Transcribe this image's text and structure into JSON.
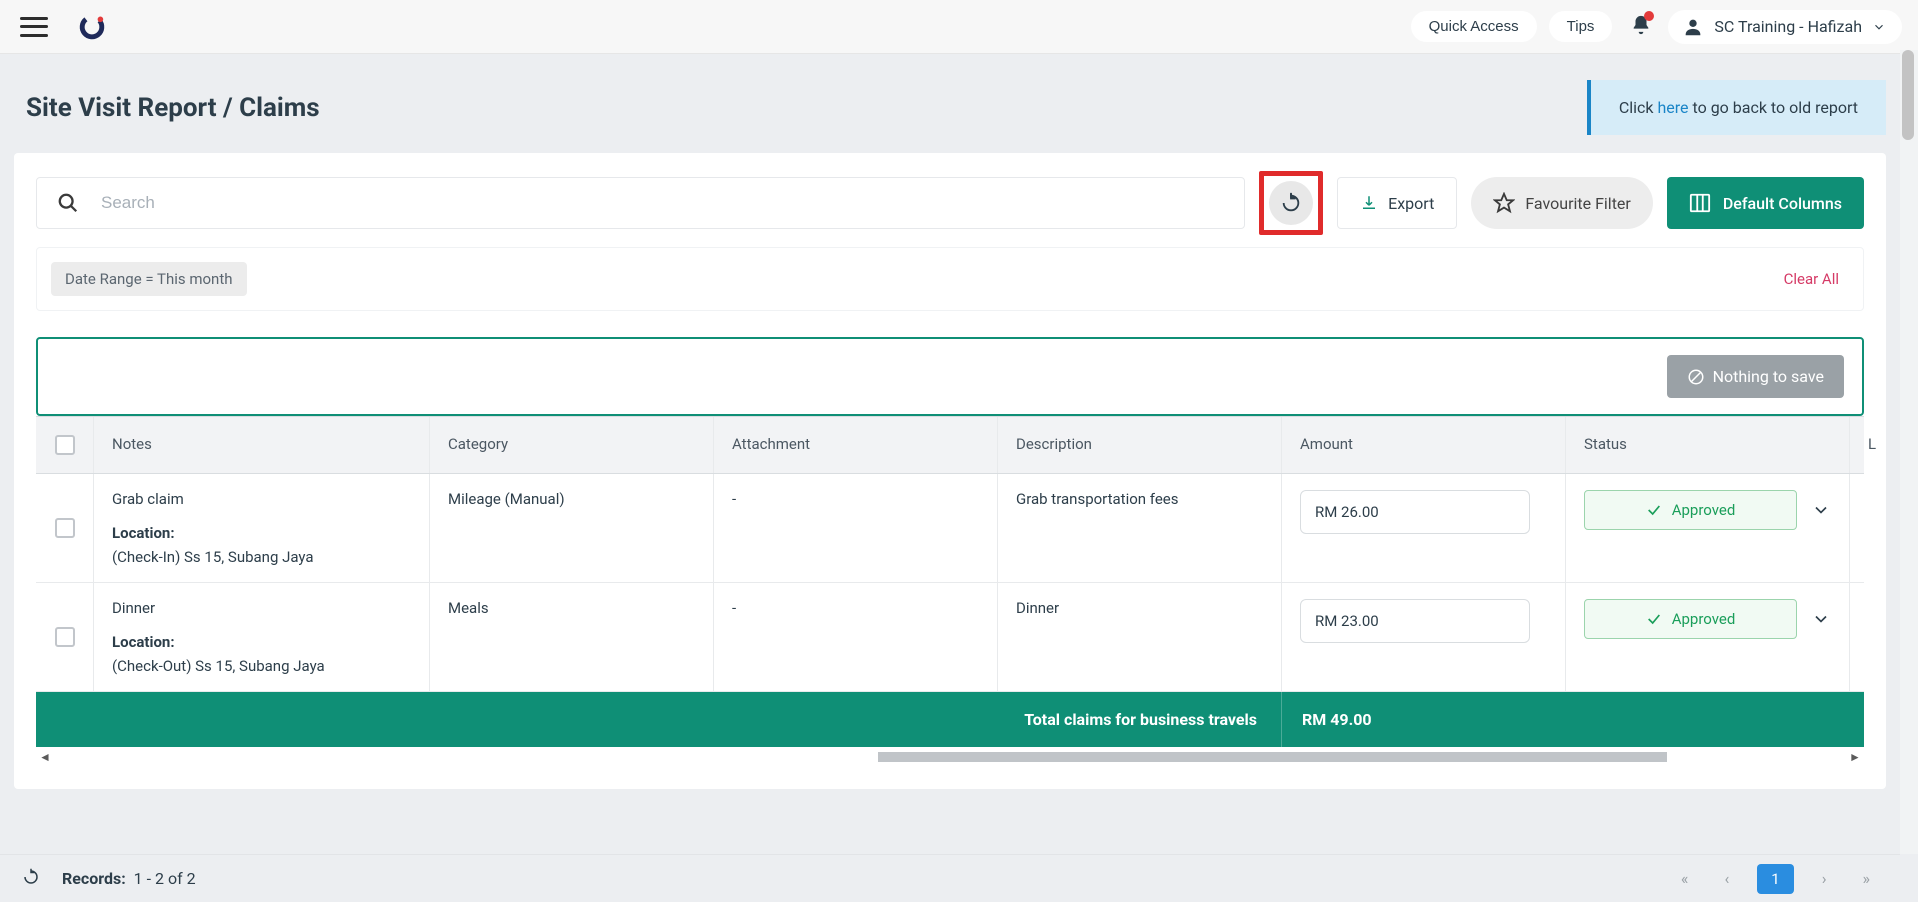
{
  "topbar": {
    "quick_access": "Quick Access",
    "tips": "Tips",
    "user_name": "SC Training - Hafizah"
  },
  "page": {
    "title": "Site Visit Report / Claims",
    "banner_prefix": "Click ",
    "banner_link": "here",
    "banner_suffix": " to go back to old report"
  },
  "toolbar": {
    "search_placeholder": "Search",
    "export": "Export",
    "favourite_filter": "Favourite Filter",
    "default_columns": "Default Columns"
  },
  "filters": {
    "chip": "Date Range  =  This month",
    "clear_all": "Clear All"
  },
  "save": {
    "nothing": "Nothing to save"
  },
  "table": {
    "headers": {
      "notes": "Notes",
      "category": "Category",
      "attachment": "Attachment",
      "description": "Description",
      "amount": "Amount",
      "status": "Status",
      "last": "L"
    },
    "rows": [
      {
        "notes_title": "Grab claim",
        "loc_label": "Location:",
        "loc_text": "(Check-In) Ss 15, Subang Jaya",
        "category": "Mileage (Manual)",
        "attachment": "-",
        "description": "Grab transportation fees",
        "amount": "RM 26.00",
        "status": "Approved"
      },
      {
        "notes_title": "Dinner",
        "loc_label": "Location:",
        "loc_text": "(Check-Out) Ss 15, Subang Jaya",
        "category": "Meals",
        "attachment": "-",
        "description": "Dinner",
        "amount": "RM 23.00",
        "status": "Approved"
      }
    ],
    "total_label": "Total claims for business travels",
    "total_amount": "RM 49.00"
  },
  "footer": {
    "records_label": "Records:",
    "records_value": "1 - 2   of   2",
    "page_current": "1"
  }
}
